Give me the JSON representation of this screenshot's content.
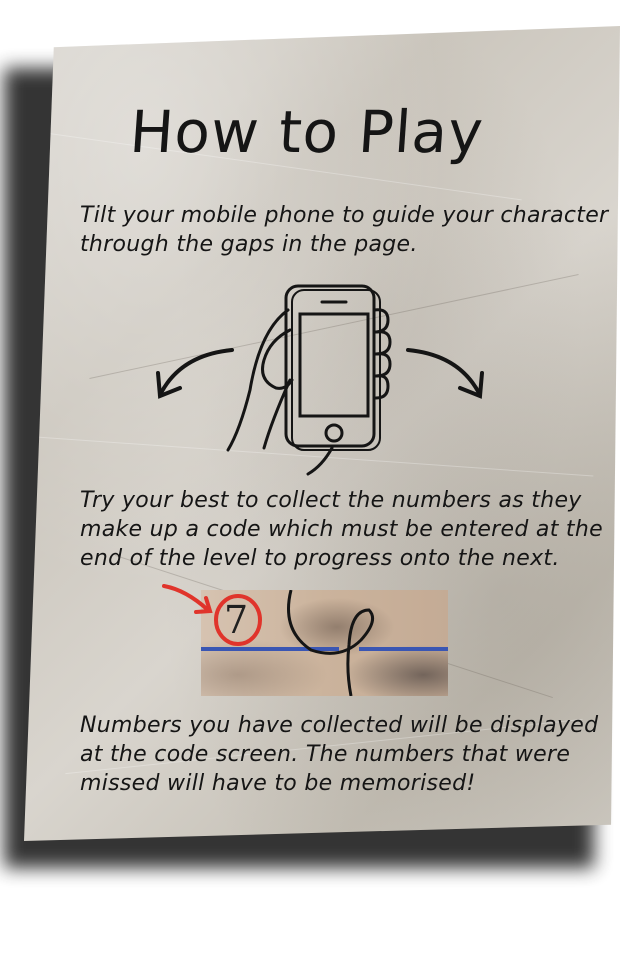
{
  "screen": {
    "title": "How to Play",
    "instructions": [
      "Tilt your mobile phone to guide your character through the gaps in the page.",
      "Try your best to collect the numbers as they make up a code which must be entered at the end of the level to progress onto the next.",
      "Numbers you have collected will be displayed at the code screen. The numbers that were missed will have to be memorised!"
    ],
    "example_number": "7"
  },
  "icons": {
    "tilt": "hand-holding-phone-icon",
    "left_arrow": "curved-arrow-left-icon",
    "right_arrow": "curved-arrow-right-icon",
    "pointer": "red-arrow-icon"
  },
  "colors": {
    "paper": "#d2cec6",
    "ink": "#151515",
    "highlight": "#e0342b",
    "gap_line": "#3a56b3"
  }
}
